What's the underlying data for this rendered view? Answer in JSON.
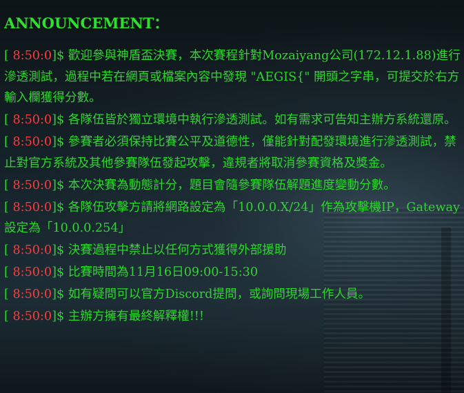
{
  "announcement": {
    "title": "ANNOUNCEMENT：",
    "entries": [
      {
        "open": "[ ",
        "time": "8:50:0",
        "close": "]$ ",
        "text": "歡迎參與神盾盃決賽，本次賽程針對Mozaiyang公司(172.12.1.88)進行滲透測試，過程中若在網頁或檔案內容中發現 \"AEGIS{\" 開頭之字串，可提交於右方輸入欄獲得分數。"
      },
      {
        "open": "[ ",
        "time": "8:50:0",
        "close": "]$ ",
        "text": "各隊伍皆於獨立環境中執行滲透測試。如有需求可告知主辦方系統還原。"
      },
      {
        "open": "[ ",
        "time": "8:50:0",
        "close": "]$ ",
        "text": "參賽者必須保持比賽公平及道德性，僅能針對配發環境進行滲透測試，禁止對官方系統及其他參賽隊伍發起攻擊，違規者將取消參賽資格及獎金。"
      },
      {
        "open": "[ ",
        "time": "8:50:0",
        "close": "]$ ",
        "text": "本次決賽為動態計分，題目會隨參賽隊伍解題進度變動分數。"
      },
      {
        "open": "[ ",
        "time": "8:50:0",
        "close": "]$ ",
        "text": "各隊伍攻擊方請將網路設定為「10.0.0.X/24」作為攻擊機IP，Gateway設定為「10.0.0.254」"
      },
      {
        "open": "[ ",
        "time": "8:50:0",
        "close": "]$ ",
        "text": "決賽過程中禁止以任何方式獲得外部援助"
      },
      {
        "open": "[ ",
        "time": "8:50:0",
        "close": "]$ ",
        "text": "比賽時間為11月16日09:00-15:30"
      },
      {
        "open": "[ ",
        "time": "8:50:0",
        "close": "]$ ",
        "text": "如有疑問可以官方Discord提問，或詢問現場工作人員。"
      },
      {
        "open": "[ ",
        "time": "8:50:0",
        "close": "]$ ",
        "text": "主辦方擁有最終解釋權!!!"
      }
    ]
  },
  "colors": {
    "text": "#2dd62d",
    "timestamp": "#ff3b3b",
    "background": "#111a1f"
  }
}
